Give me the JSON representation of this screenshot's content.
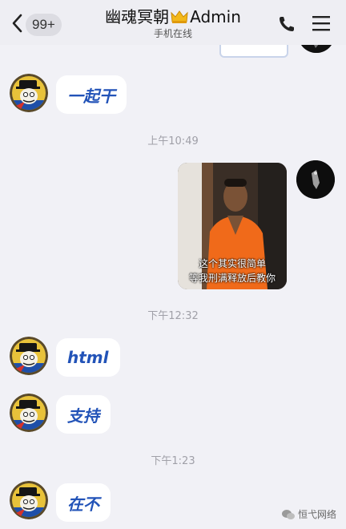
{
  "header": {
    "unread_count": "99+",
    "title": "幽魂冥朝",
    "title_suffix": "Admin",
    "crown_icon": "crown-icon",
    "subtitle": "手机在线",
    "call_icon": "phone-icon",
    "menu_icon": "menu-icon"
  },
  "messages": [
    {
      "side": "left",
      "type": "text",
      "text": "一起干"
    },
    {
      "type": "time",
      "text": "上午10:49"
    },
    {
      "side": "right",
      "type": "image",
      "caption_lines": [
        "这个其实很简单",
        "等我刑满释放后教你"
      ]
    },
    {
      "type": "time",
      "text": "下午12:32"
    },
    {
      "side": "left",
      "type": "text",
      "text": "html"
    },
    {
      "side": "left",
      "type": "text",
      "text": "支持"
    },
    {
      "type": "time",
      "text": "下午1:23"
    },
    {
      "side": "left",
      "type": "text",
      "text": "在不"
    }
  ],
  "watermark": {
    "text": "恒弋网络"
  },
  "colors": {
    "accent_text": "#2253b8",
    "background": "#f1f1f6"
  }
}
